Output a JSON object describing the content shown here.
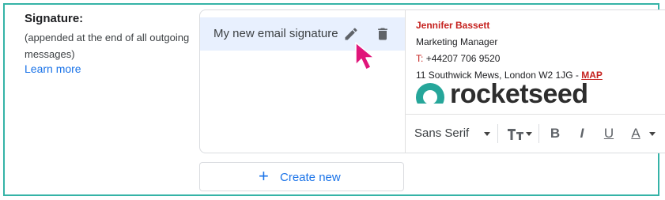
{
  "settings": {
    "heading": "Signature:",
    "description": "(appended at the end of all outgoing messages)",
    "learn_more": "Learn more"
  },
  "signatures": {
    "items": [
      {
        "name": "My new email signature",
        "selected": true
      }
    ],
    "create_new_label": "Create new"
  },
  "preview": {
    "name": "Jennifer Bassett",
    "title": "Marketing Manager",
    "phone_prefix": "T:",
    "phone": "+44207 706 9520",
    "address": "11 Southwick Mews, London W2 1JG -",
    "map_link": "MAP",
    "logo_text": "rocketseed"
  },
  "toolbar": {
    "font": "Sans Serif",
    "buttons": [
      "font-size-icon",
      "bold-icon",
      "italic-icon",
      "underline-icon",
      "text-color-icon"
    ],
    "bold_label": "B",
    "italic_label": "I",
    "underline_label": "U",
    "text_color_label": "A"
  },
  "colors": {
    "accent": "#1a73e8",
    "frame": "#35b3a7",
    "selected_bg": "#e8f0fe",
    "signature_red": "#c5221f",
    "cursor": "#e0157a"
  }
}
